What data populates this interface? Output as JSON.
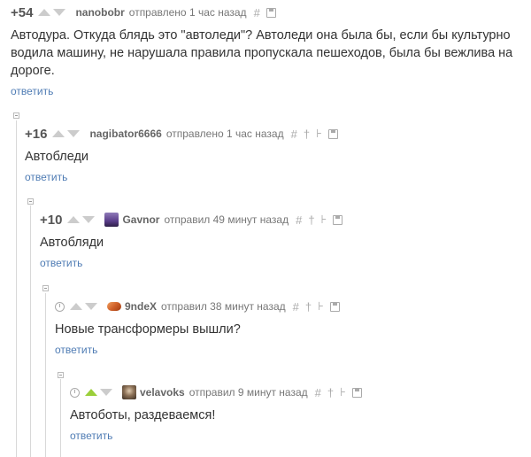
{
  "comments": [
    {
      "rating": "+54",
      "author": "nanobobr",
      "meta": "отправлено 1 час назад",
      "text": "Автодура. Откуда блядь это \"автоледи\"? Автоледи она была бы, если бы культурно водила машину, не нарушала правила пропускала пешеходов, была бы вежлива на дороге.",
      "reply": "ответить"
    },
    {
      "rating": "+16",
      "author": "nagibator6666",
      "meta": "отправлено 1 час назад",
      "text": "Автобледи",
      "reply": "ответить"
    },
    {
      "rating": "+10",
      "author": "Gavnor",
      "meta": "отправил 49 минут назад",
      "text": "Автобляди",
      "reply": "ответить"
    },
    {
      "author": "9ndeX",
      "meta": "отправил 38 минут назад",
      "text": "Новые трансформеры вышли?",
      "reply": "ответить"
    },
    {
      "author": "velavoks",
      "meta": "отправил 9 минут назад",
      "text": "Автоботы, раздеваемся!",
      "reply": "ответить"
    }
  ],
  "icons": {
    "hash": "#",
    "dagger": "†",
    "branch": "⊦"
  },
  "colors": {
    "link": "#4f7cb4",
    "upvote_active": "#9bcf3a",
    "gavnor_avatar": "#5a3d8a",
    "ndex_avatar": "#d0612a",
    "velavoks_avatar": "#6b5a4a"
  }
}
